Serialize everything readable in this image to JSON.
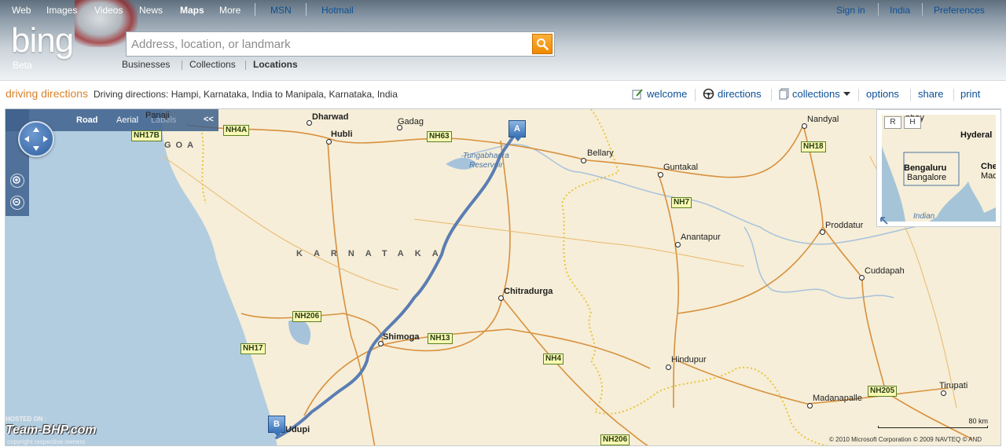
{
  "topnav": {
    "left": [
      "Web",
      "Images",
      "Videos",
      "News",
      "Maps",
      "More"
    ],
    "active": "Maps",
    "links": [
      "MSN",
      "Hotmail"
    ],
    "right": [
      "Sign in",
      "India",
      "Preferences"
    ]
  },
  "logo": {
    "text": "bing",
    "beta": "Beta"
  },
  "search": {
    "placeholder": "Address, location, or landmark",
    "value": ""
  },
  "subnav": [
    "Businesses",
    "Collections",
    "Locations"
  ],
  "toolbar": {
    "title": "driving directions",
    "description": "Driving directions: Hampi, Karnataka, India to Manipala, Karnataka, India",
    "actions": {
      "welcome": "welcome",
      "directions": "directions",
      "collections": "collections",
      "options": "options",
      "share": "share",
      "print": "print"
    }
  },
  "map_style": {
    "road": "Road",
    "aerial": "Aerial",
    "labels": "Labels",
    "collapse": "<<"
  },
  "map": {
    "start_pin": "A",
    "end_pin": "B",
    "state_label": "KARNATAKA",
    "goa_label": "GOA",
    "reservoir_label": [
      "Tungabhadra",
      "Reservoir"
    ],
    "cities": {
      "panaji": "Panaji",
      "dharwad": "Dharwad",
      "hubli": "Hubli",
      "gadag": "Gadag",
      "bellary": "Bellary",
      "guntakal": "Guntakal",
      "nandyal": "Nandyal",
      "anantapur": "Anantapur",
      "proddatur": "Proddatur",
      "cuddapah": "Cuddapah",
      "chitradurga": "Chitradurga",
      "shimoga": "Shimoga",
      "hindupur": "Hindupur",
      "madanapalle": "Madanapalle",
      "tirupati": "Tirupati",
      "udupi": "Udupi"
    },
    "highways": {
      "nh17b": "NH17B",
      "nh4a": "NH4A",
      "nh63": "NH63",
      "nh18": "NH18",
      "nh7": "NH7",
      "nh206a": "NH206",
      "nh17": "NH17",
      "nh13": "NH13",
      "nh4": "NH4",
      "nh205": "NH205",
      "nh206b": "NH206"
    },
    "scale": "80 km",
    "copyright": "© 2010 Microsoft Corporation   © 2009 NAVTEQ   © AND"
  },
  "minimap": {
    "btn_r": "R",
    "btn_h": "H",
    "cities": [
      "nbay",
      "Hyderal",
      "Bengaluru",
      "Bangalore",
      "Che",
      "Madr",
      "Indian"
    ]
  },
  "watermark": {
    "hosted": "HOSTED ON :",
    "brand": "Team-BHP.com",
    "sub": "copyright respective owners"
  },
  "colors": {
    "accent_orange": "#d9822b",
    "link_blue": "#0b4f96",
    "route_blue": "#5b7db3",
    "road_orange": "#d8903e"
  }
}
